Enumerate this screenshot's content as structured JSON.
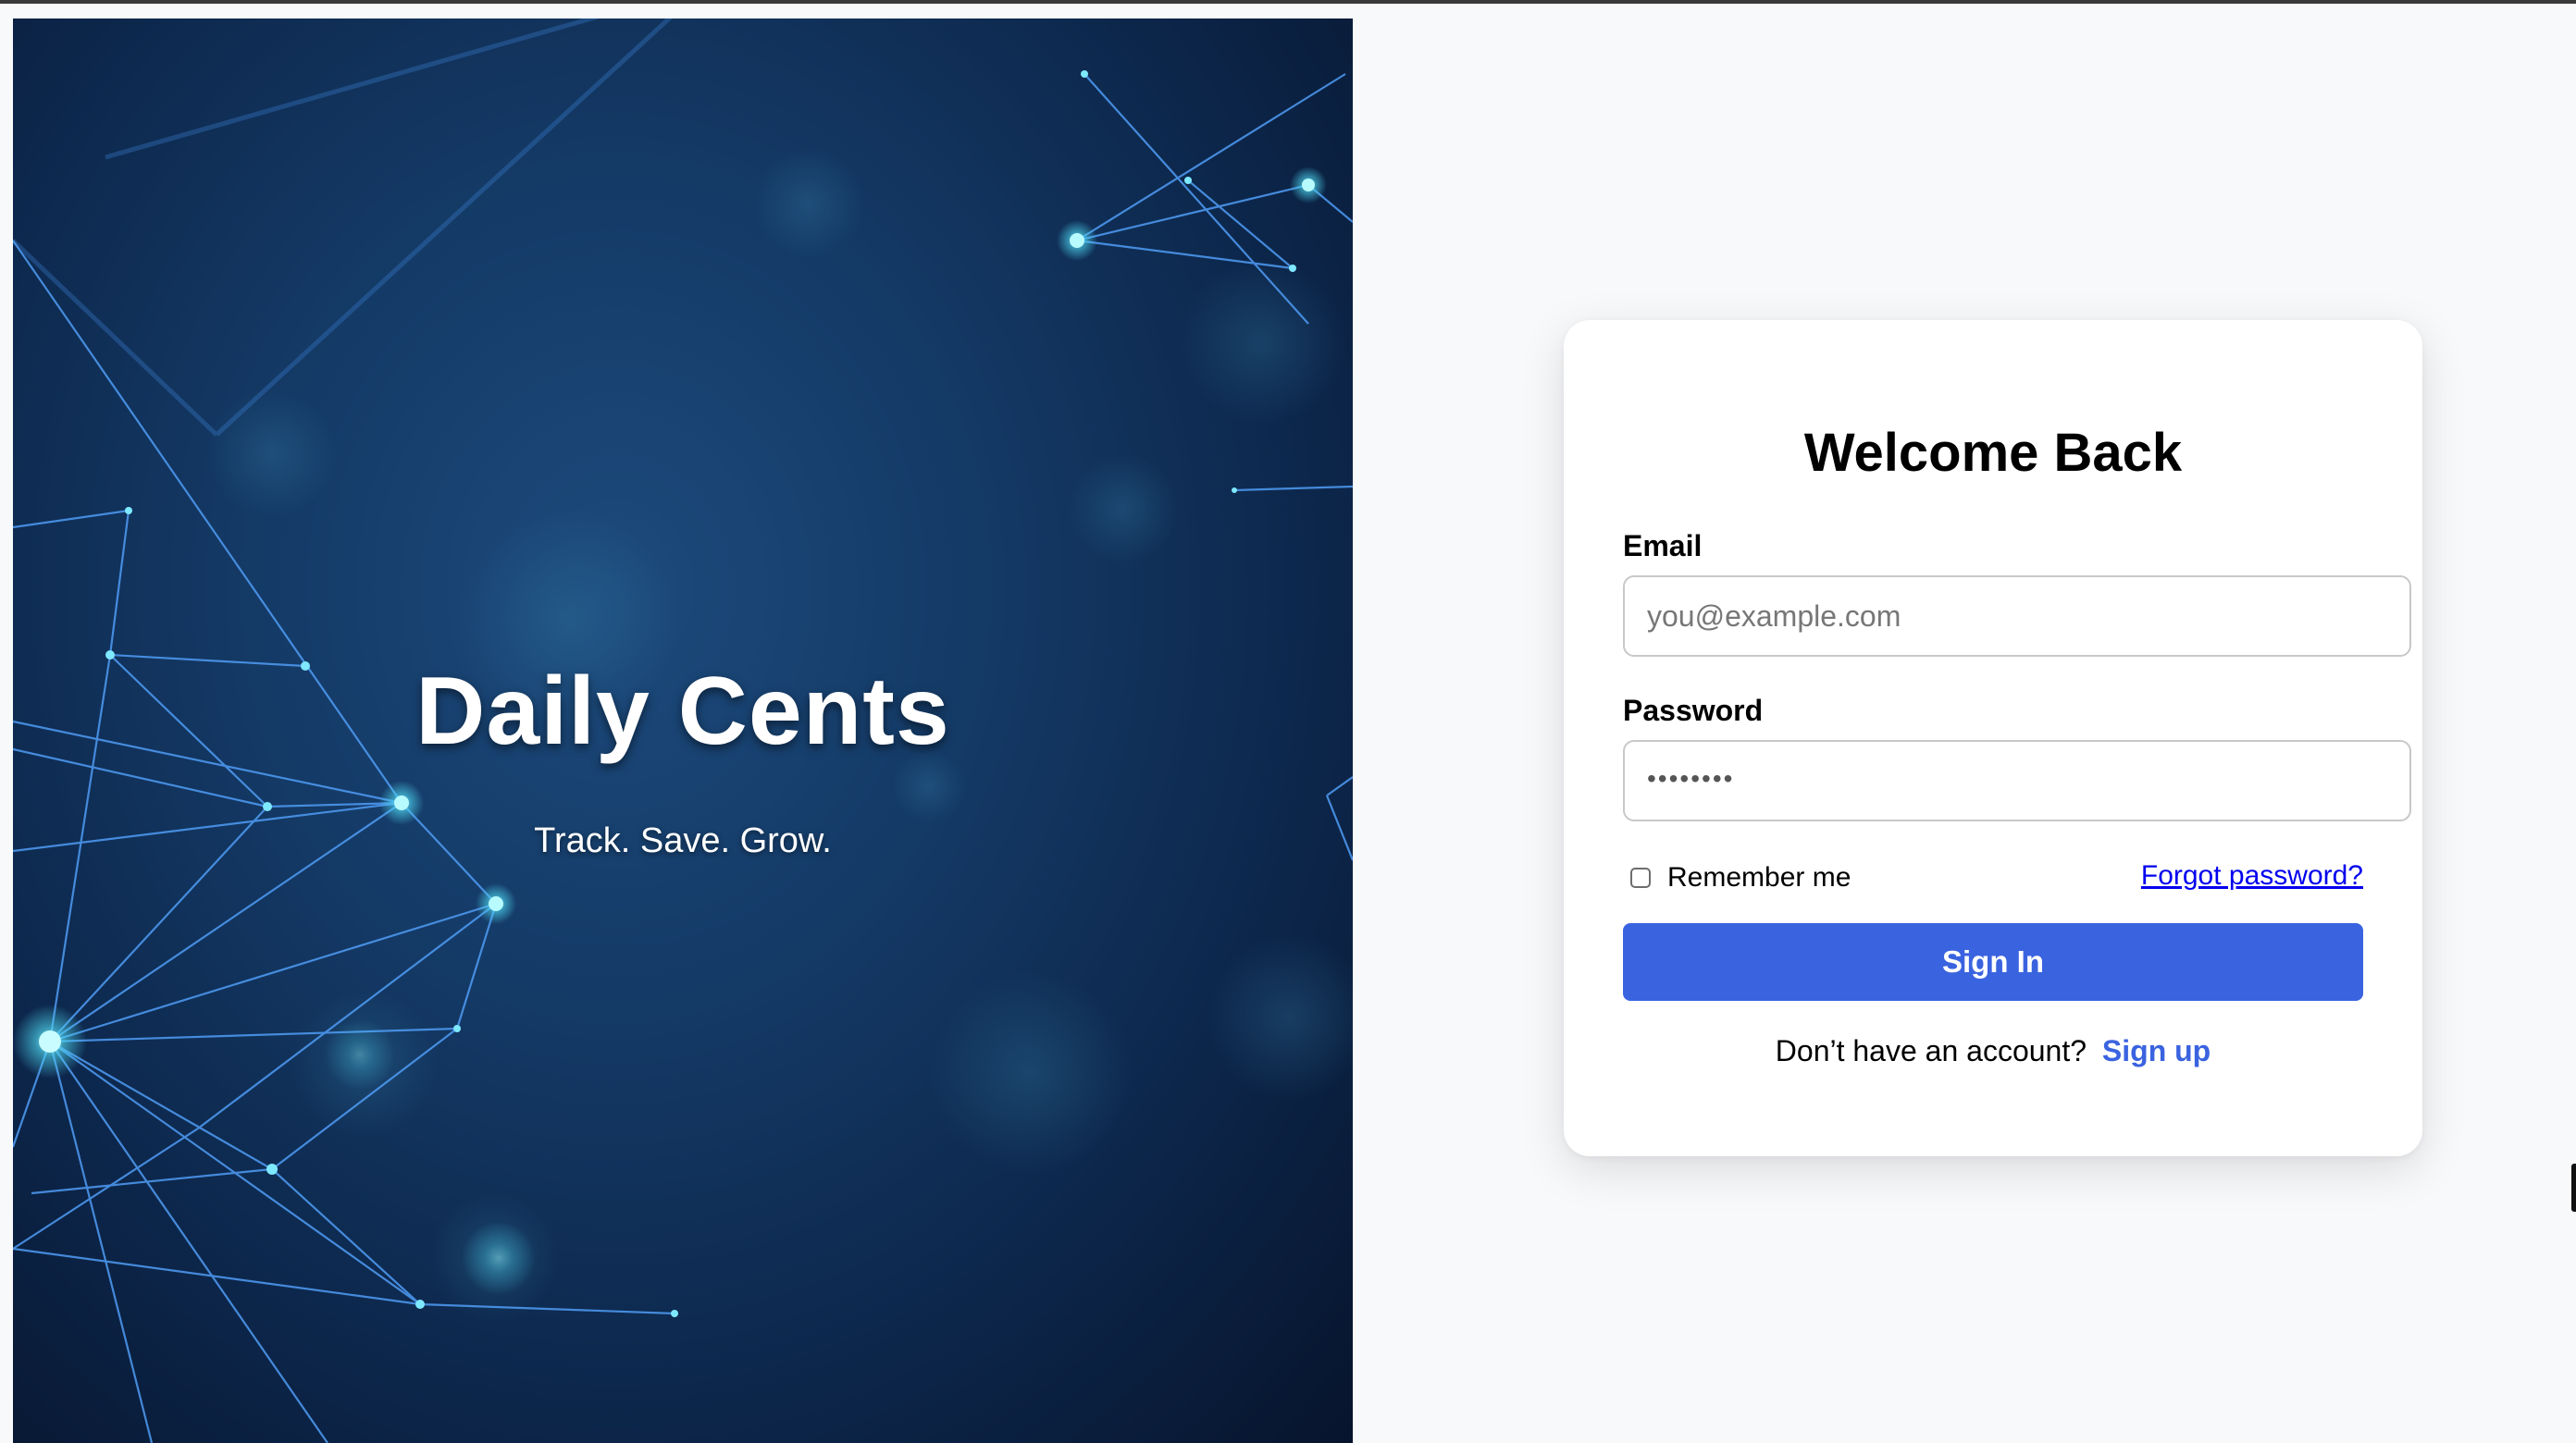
{
  "hero": {
    "title": "Daily Cents",
    "subtitle": "Track. Save. Grow."
  },
  "login": {
    "title": "Welcome Back",
    "email_label": "Email",
    "email_placeholder": "you@example.com",
    "password_label": "Password",
    "password_value": "••••••••",
    "remember_label": "Remember me",
    "remember_checked": false,
    "forgot_label": "Forgot password?",
    "signin_label": "Sign In",
    "signup_prompt": "Don’t have an account?",
    "signup_label": "Sign up"
  },
  "colors": {
    "accent": "#3a63e0",
    "link": "#0000ee",
    "hero_background": "#143a66",
    "page_background": "#f8f9fb"
  }
}
